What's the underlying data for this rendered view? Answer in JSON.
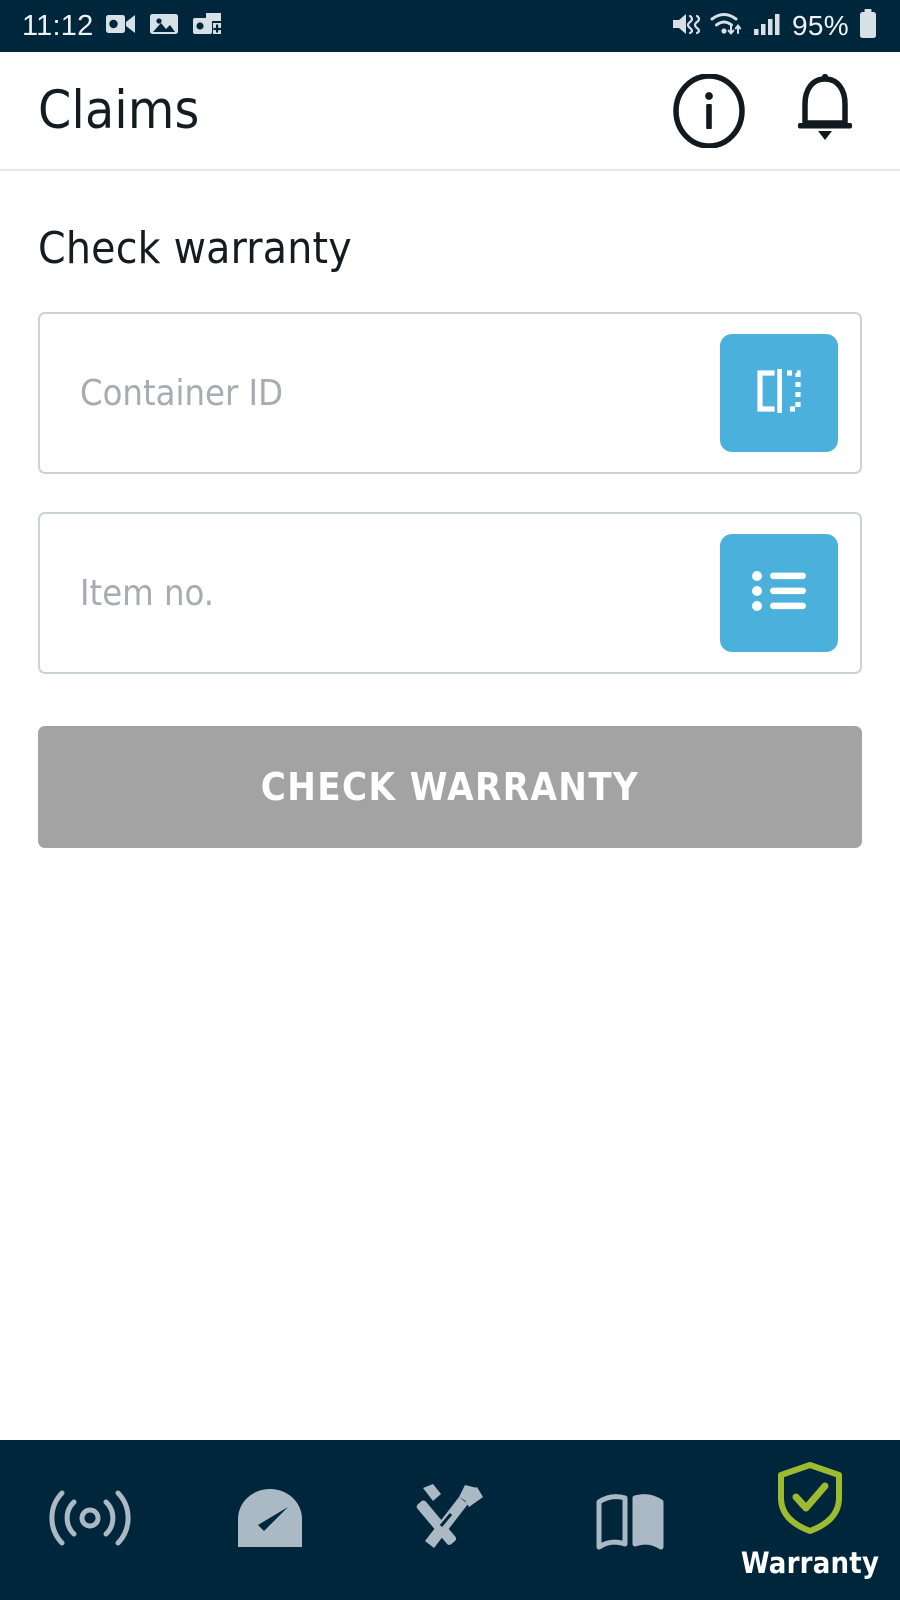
{
  "colors": {
    "navy": "#00263c",
    "accent_blue": "#4bb0db",
    "disabled_gray": "#a3a3a3",
    "active_green": "#9cbb31",
    "field_border": "#c9d3d9",
    "placeholder": "#a6adb2"
  },
  "statusbar": {
    "time": "11:12",
    "battery_percent": "95%",
    "left_icons": [
      {
        "name": "outlook-video-icon"
      },
      {
        "name": "photo-gallery-icon"
      },
      {
        "name": "outlook-add-icon"
      }
    ],
    "right_icons": [
      {
        "name": "volume-mute-icon"
      },
      {
        "name": "wifi-icon"
      },
      {
        "name": "cellular-signal-icon"
      },
      {
        "name": "battery-icon"
      }
    ]
  },
  "header": {
    "title": "Claims",
    "info_icon": "info-circle-icon",
    "notification_icon": "bell-icon"
  },
  "main": {
    "section_title": "Check warranty",
    "fields": [
      {
        "name": "container-id",
        "value": "",
        "placeholder": "Container ID",
        "action_icon": "barcode-scan-icon",
        "action_name": "scan-container-id-button"
      },
      {
        "name": "item-no",
        "value": "",
        "placeholder": "Item no.",
        "action_icon": "list-icon",
        "action_name": "select-item-no-button"
      }
    ],
    "submit_label": "CHECK WARRANTY"
  },
  "bottomnav": {
    "items": [
      {
        "label": "",
        "icon": "broadcast-signal-icon",
        "name": "nav-connect",
        "active": false
      },
      {
        "label": "",
        "icon": "gauge-icon",
        "name": "nav-performance",
        "active": false
      },
      {
        "label": "",
        "icon": "tools-icon",
        "name": "nav-service",
        "active": false
      },
      {
        "label": "",
        "icon": "open-book-icon",
        "name": "nav-manuals",
        "active": false
      },
      {
        "label": "Warranty",
        "icon": "shield-check-icon",
        "name": "nav-warranty",
        "active": true
      }
    ]
  }
}
